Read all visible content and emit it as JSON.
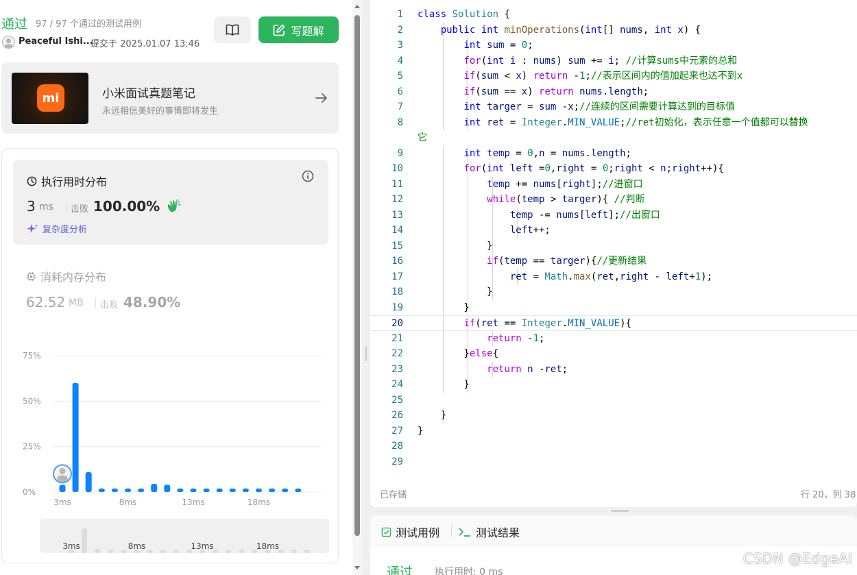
{
  "submission": {
    "status": "通过",
    "pass_count": "97 / 97 个通过的测试用例",
    "username": "Peaceful Ishi...",
    "submitted_at": "提交于 2025.01.07 13:46",
    "write_solution_label": "写题解"
  },
  "promo": {
    "logo_text": "mi",
    "title": "小米面试真题笔记",
    "subtitle": "永远相信美好的事情即将发生"
  },
  "runtime": {
    "title": "执行用时分布",
    "value": "3",
    "unit": "ms",
    "beat_label": "击败",
    "beat_value": "100.00%",
    "complexity_label": "复杂度分析"
  },
  "memory": {
    "title": "消耗内存分布",
    "value": "62.52",
    "unit": "MB",
    "beat_label": "击败",
    "beat_value": "48.90%"
  },
  "chart_data": {
    "type": "bar",
    "title": "",
    "xlabel": "",
    "ylabel": "",
    "ylim": [
      0,
      75
    ],
    "yticks": [
      "0%",
      "25%",
      "50%",
      "75%"
    ],
    "ytick_values": [
      0,
      25,
      50,
      75
    ],
    "xtick_labels": [
      "3ms",
      "8ms",
      "13ms",
      "18ms"
    ],
    "xtick_indices": [
      0,
      5,
      10,
      15
    ],
    "values": [
      4,
      60,
      11,
      2,
      2,
      2,
      2,
      4.5,
      4,
      2,
      2,
      2,
      2,
      2,
      2,
      2,
      2,
      2,
      2
    ],
    "highlight_index": 0,
    "bar_color": "#0a84ff",
    "minimap_labels": [
      "3ms",
      "8ms",
      "13ms",
      "18ms"
    ]
  },
  "editor": {
    "lines": [
      {
        "n": "1",
        "html": "<span class=\"kw\">class</span> <span class=\"typ\">Solution</span> {"
      },
      {
        "n": "2",
        "html": "    <span class=\"kw\">public</span> <span class=\"kw\">int</span> <span class=\"fn\">minOperations</span>(<span class=\"kw\">int</span>[] <span class=\"vr\">nums</span>, <span class=\"kw\">int</span> <span class=\"vr\">x</span>) {"
      },
      {
        "n": "3",
        "html": "        <span class=\"kw\">int</span> <span class=\"vr\">sum</span> = <span class=\"num\">0</span>;"
      },
      {
        "n": "4",
        "html": "        <span class=\"ctl\">for</span>(<span class=\"kw\">int</span> <span class=\"vr\">i</span> : <span class=\"vr\">nums</span>) <span class=\"vr\">sum</span> += <span class=\"vr\">i</span>; <span class=\"cm\">//计算sums中元素的总和</span>"
      },
      {
        "n": "5",
        "html": "        <span class=\"ctl\">if</span>(<span class=\"vr\">sum</span> &lt; <span class=\"vr\">x</span>) <span class=\"ctl\">return</span> -<span class=\"num\">1</span>;<span class=\"cm\">//表示区间内的值加起来也达不到x</span>"
      },
      {
        "n": "6",
        "html": "        <span class=\"ctl\">if</span>(<span class=\"vr\">sum</span> == <span class=\"vr\">x</span>) <span class=\"ctl\">return</span> <span class=\"vr\">nums</span>.<span class=\"vr\">length</span>;"
      },
      {
        "n": "7",
        "html": "        <span class=\"kw\">int</span> <span class=\"vr\">targer</span> = <span class=\"vr\">sum</span> -<span class=\"vr\">x</span>;<span class=\"cm\">//连续的区间需要计算达到的目标值</span>"
      },
      {
        "n": "8",
        "html": "        <span class=\"kw\">int</span> <span class=\"vr\">ret</span> = <span class=\"typ\">Integer</span>.<span class=\"cn\">MIN_VALUE</span>;<span class=\"cm\">//ret初始化，表示任意一个值都可以替换</span>"
      },
      {
        "n": "",
        "html": "<span class=\"cm\">它</span>",
        "wrap": true
      },
      {
        "n": "9",
        "html": "        <span class=\"kw\">int</span> <span class=\"vr\">temp</span> = <span class=\"num\">0</span>,<span class=\"vr\">n</span> = <span class=\"vr\">nums</span>.<span class=\"vr\">length</span>;"
      },
      {
        "n": "10",
        "html": "        <span class=\"ctl\">for</span>(<span class=\"kw\">int</span> <span class=\"vr\">left</span> =<span class=\"num\">0</span>,<span class=\"vr\">right</span> = <span class=\"num\">0</span>;<span class=\"vr\">right</span> &lt; <span class=\"vr\">n</span>;<span class=\"vr\">right</span>++){"
      },
      {
        "n": "11",
        "html": "            <span class=\"vr\">temp</span> += <span class=\"vr\">nums</span>[<span class=\"vr\">right</span>];<span class=\"cm\">//进窗口</span>"
      },
      {
        "n": "12",
        "html": "            <span class=\"ctl\">while</span>(<span class=\"vr\">temp</span> &gt; <span class=\"vr\">targer</span>){ <span class=\"cm\">//判断</span>"
      },
      {
        "n": "13",
        "html": "                <span class=\"vr\">temp</span> -= <span class=\"vr\">nums</span>[<span class=\"vr\">left</span>];<span class=\"cm\">//出窗口</span>"
      },
      {
        "n": "14",
        "html": "                <span class=\"vr\">left</span>++;"
      },
      {
        "n": "15",
        "html": "            }"
      },
      {
        "n": "16",
        "html": "            <span class=\"ctl\">if</span>(<span class=\"vr\">temp</span> == <span class=\"vr\">targer</span>){<span class=\"cm\">//更新结果</span>"
      },
      {
        "n": "17",
        "html": "                <span class=\"vr\">ret</span> = <span class=\"typ\">Math</span>.<span class=\"fn\">max</span>(<span class=\"vr\">ret</span>,<span class=\"vr\">right</span> - <span class=\"vr\">left</span>+<span class=\"num\">1</span>);"
      },
      {
        "n": "18",
        "html": "            }"
      },
      {
        "n": "19",
        "html": "        }"
      },
      {
        "n": "20",
        "html": "        <span class=\"ctl\">if</span>(<span class=\"vr\">ret</span> == <span class=\"typ\">Integer</span>.<span class=\"cn\">MIN_VALUE</span>){",
        "current": true
      },
      {
        "n": "21",
        "html": "            <span class=\"ctl\">return</span> -<span class=\"num\">1</span>;"
      },
      {
        "n": "22",
        "html": "        }<span class=\"ctl\">else</span>{"
      },
      {
        "n": "23",
        "html": "            <span class=\"ctl\">return</span> <span class=\"vr\">n</span> -<span class=\"vr\">ret</span>;"
      },
      {
        "n": "24",
        "html": "        }"
      },
      {
        "n": "25",
        "html": ""
      },
      {
        "n": "26",
        "html": "    }"
      },
      {
        "n": "27",
        "html": "}"
      },
      {
        "n": "28",
        "html": ""
      },
      {
        "n": "29",
        "html": ""
      }
    ],
    "saved_label": "已存储",
    "cursor_pos": "行 20，列 38"
  },
  "bottom": {
    "tab_testcase": "测试用例",
    "tab_result": "测试结果",
    "result_status": "通过",
    "result_time": "执行用时: 0 ms"
  },
  "watermark": "CSDN @EdgeAI"
}
